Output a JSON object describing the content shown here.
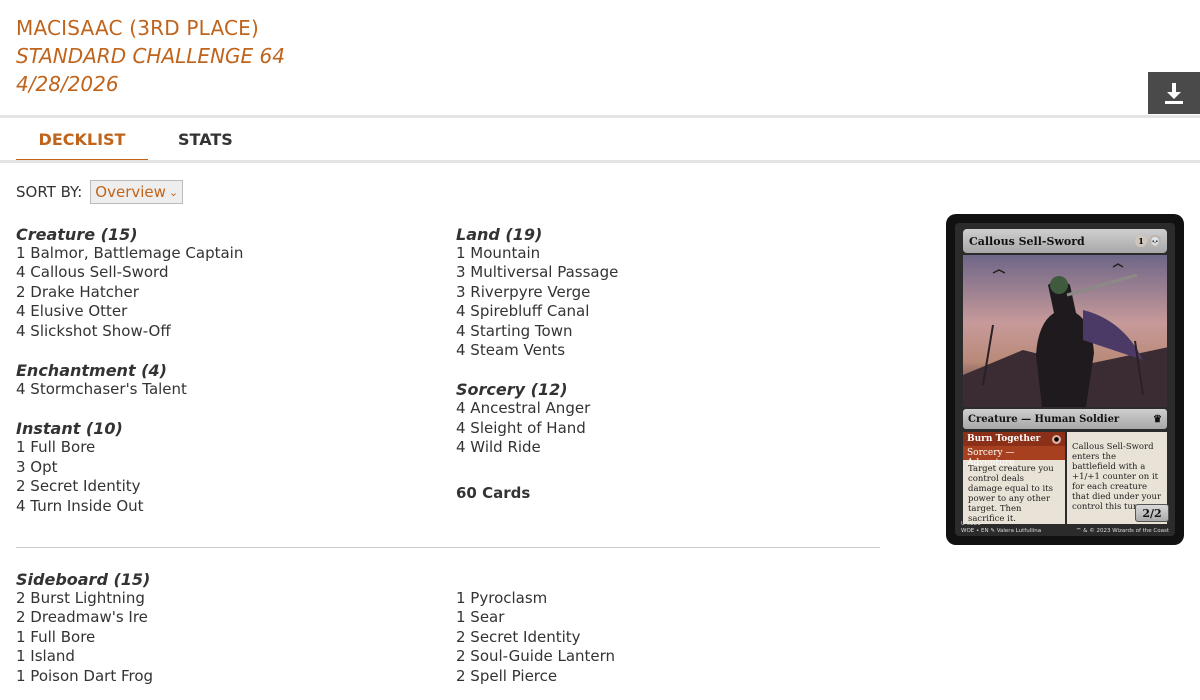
{
  "header": {
    "player": "MACISAAC (3RD PLACE)",
    "event": "STANDARD CHALLENGE 64",
    "date": "4/28/2026"
  },
  "tabs": [
    {
      "label": "DECKLIST",
      "active": true
    },
    {
      "label": "STATS",
      "active": false
    }
  ],
  "sort": {
    "label": "SORT BY:",
    "selected": "Overview"
  },
  "main_left": [
    {
      "title": "Creature (15)",
      "cards": [
        "1 Balmor, Battlemage Captain",
        "4 Callous Sell-Sword",
        "2 Drake Hatcher",
        "4 Elusive Otter",
        "4 Slickshot Show-Off"
      ]
    },
    {
      "title": "Enchantment (4)",
      "cards": [
        "4 Stormchaser's Talent"
      ]
    },
    {
      "title": "Instant (10)",
      "cards": [
        "1 Full Bore",
        "3 Opt",
        "2 Secret Identity",
        "4 Turn Inside Out"
      ]
    }
  ],
  "main_right": [
    {
      "title": "Land (19)",
      "cards": [
        "1 Mountain",
        "3 Multiversal Passage",
        "3 Riverpyre Verge",
        "4 Spirebluff Canal",
        "4 Starting Town",
        "4 Steam Vents"
      ]
    },
    {
      "title": "Sorcery (12)",
      "cards": [
        "4 Ancestral Anger",
        "4 Sleight of Hand",
        "4 Wild Ride"
      ]
    }
  ],
  "total": "60 Cards",
  "sideboard": {
    "title": "Sideboard (15)",
    "left": [
      "2 Burst Lightning",
      "2 Dreadmaw's Ire",
      "1 Full Bore",
      "1 Island",
      "1 Poison Dart Frog"
    ],
    "right": [
      "1 Pyroclasm",
      "1 Sear",
      "2 Secret Identity",
      "2 Soul-Guide Lantern",
      "2 Spell Pierce"
    ]
  },
  "card_preview": {
    "name": "Callous Sell-Sword",
    "cost": "1",
    "type_line": "Creature — Human Soldier",
    "adventure_name": "Burn Together",
    "adventure_type": "Sorcery — Adventure",
    "adventure_text": "Target creature you control deals damage equal to its power to any other target. Then sacrifice it.",
    "main_text": "Callous Sell-Sword enters the battlefield with a +1/+1 counter on it for each creature that died under your control this turn.",
    "pt": "2/2",
    "collector_number": "U 0221",
    "set_line": "WOE • EN",
    "artist": "Valera Lutfullina",
    "copyright": "™ & © 2023 Wizards of the Coast"
  },
  "colors": {
    "accent": "#c0641c",
    "download_bg": "#4a4a4a"
  },
  "icons": {
    "download": "download-icon",
    "select": "chevron-down-icon"
  }
}
